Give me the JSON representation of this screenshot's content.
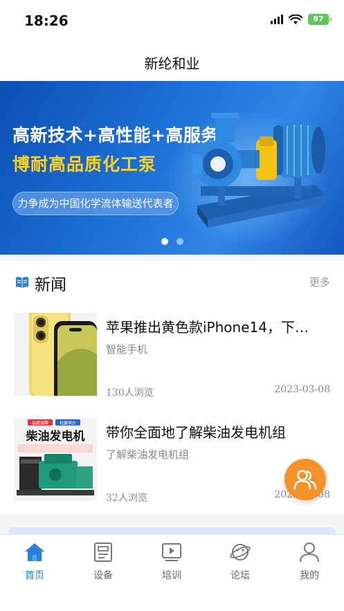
{
  "status_bar": {
    "time": "18:26",
    "battery": "87"
  },
  "nav": {
    "title": "新纶和业"
  },
  "banner": {
    "headline": "高新技术+高性能+高服务=",
    "subheadline": "博耐高品质化工泵",
    "tagline": "力争成为中国化学流体输送代表者",
    "slide_count": 2,
    "active_slide": 1
  },
  "news": {
    "section_title": "新闻",
    "more_label": "更多",
    "items": [
      {
        "title": "苹果推出黄色款iPhone14，下…",
        "category": "智能手机",
        "views": "130人浏览",
        "date": "2023-03-08"
      },
      {
        "title": "带你全面地了解柴油发电机组",
        "category": "了解柴油发电机组",
        "views": "32人浏览",
        "date": "2023-03-08"
      }
    ],
    "thumb2_banner_text": "柴油发电机",
    "thumb2_tags": [
      "品质保障",
      "批量供应"
    ]
  },
  "tabs": [
    {
      "label": "首页",
      "icon": "home-icon",
      "active": true
    },
    {
      "label": "设备",
      "icon": "device-icon",
      "active": false
    },
    {
      "label": "培训",
      "icon": "training-icon",
      "active": false
    },
    {
      "label": "论坛",
      "icon": "forum-icon",
      "active": false
    },
    {
      "label": "我的",
      "icon": "profile-icon",
      "active": false
    }
  ],
  "colors": {
    "accent": "#2b7fd9",
    "float_button": "#f5922a",
    "banner_highlight": "#ffd21f"
  }
}
